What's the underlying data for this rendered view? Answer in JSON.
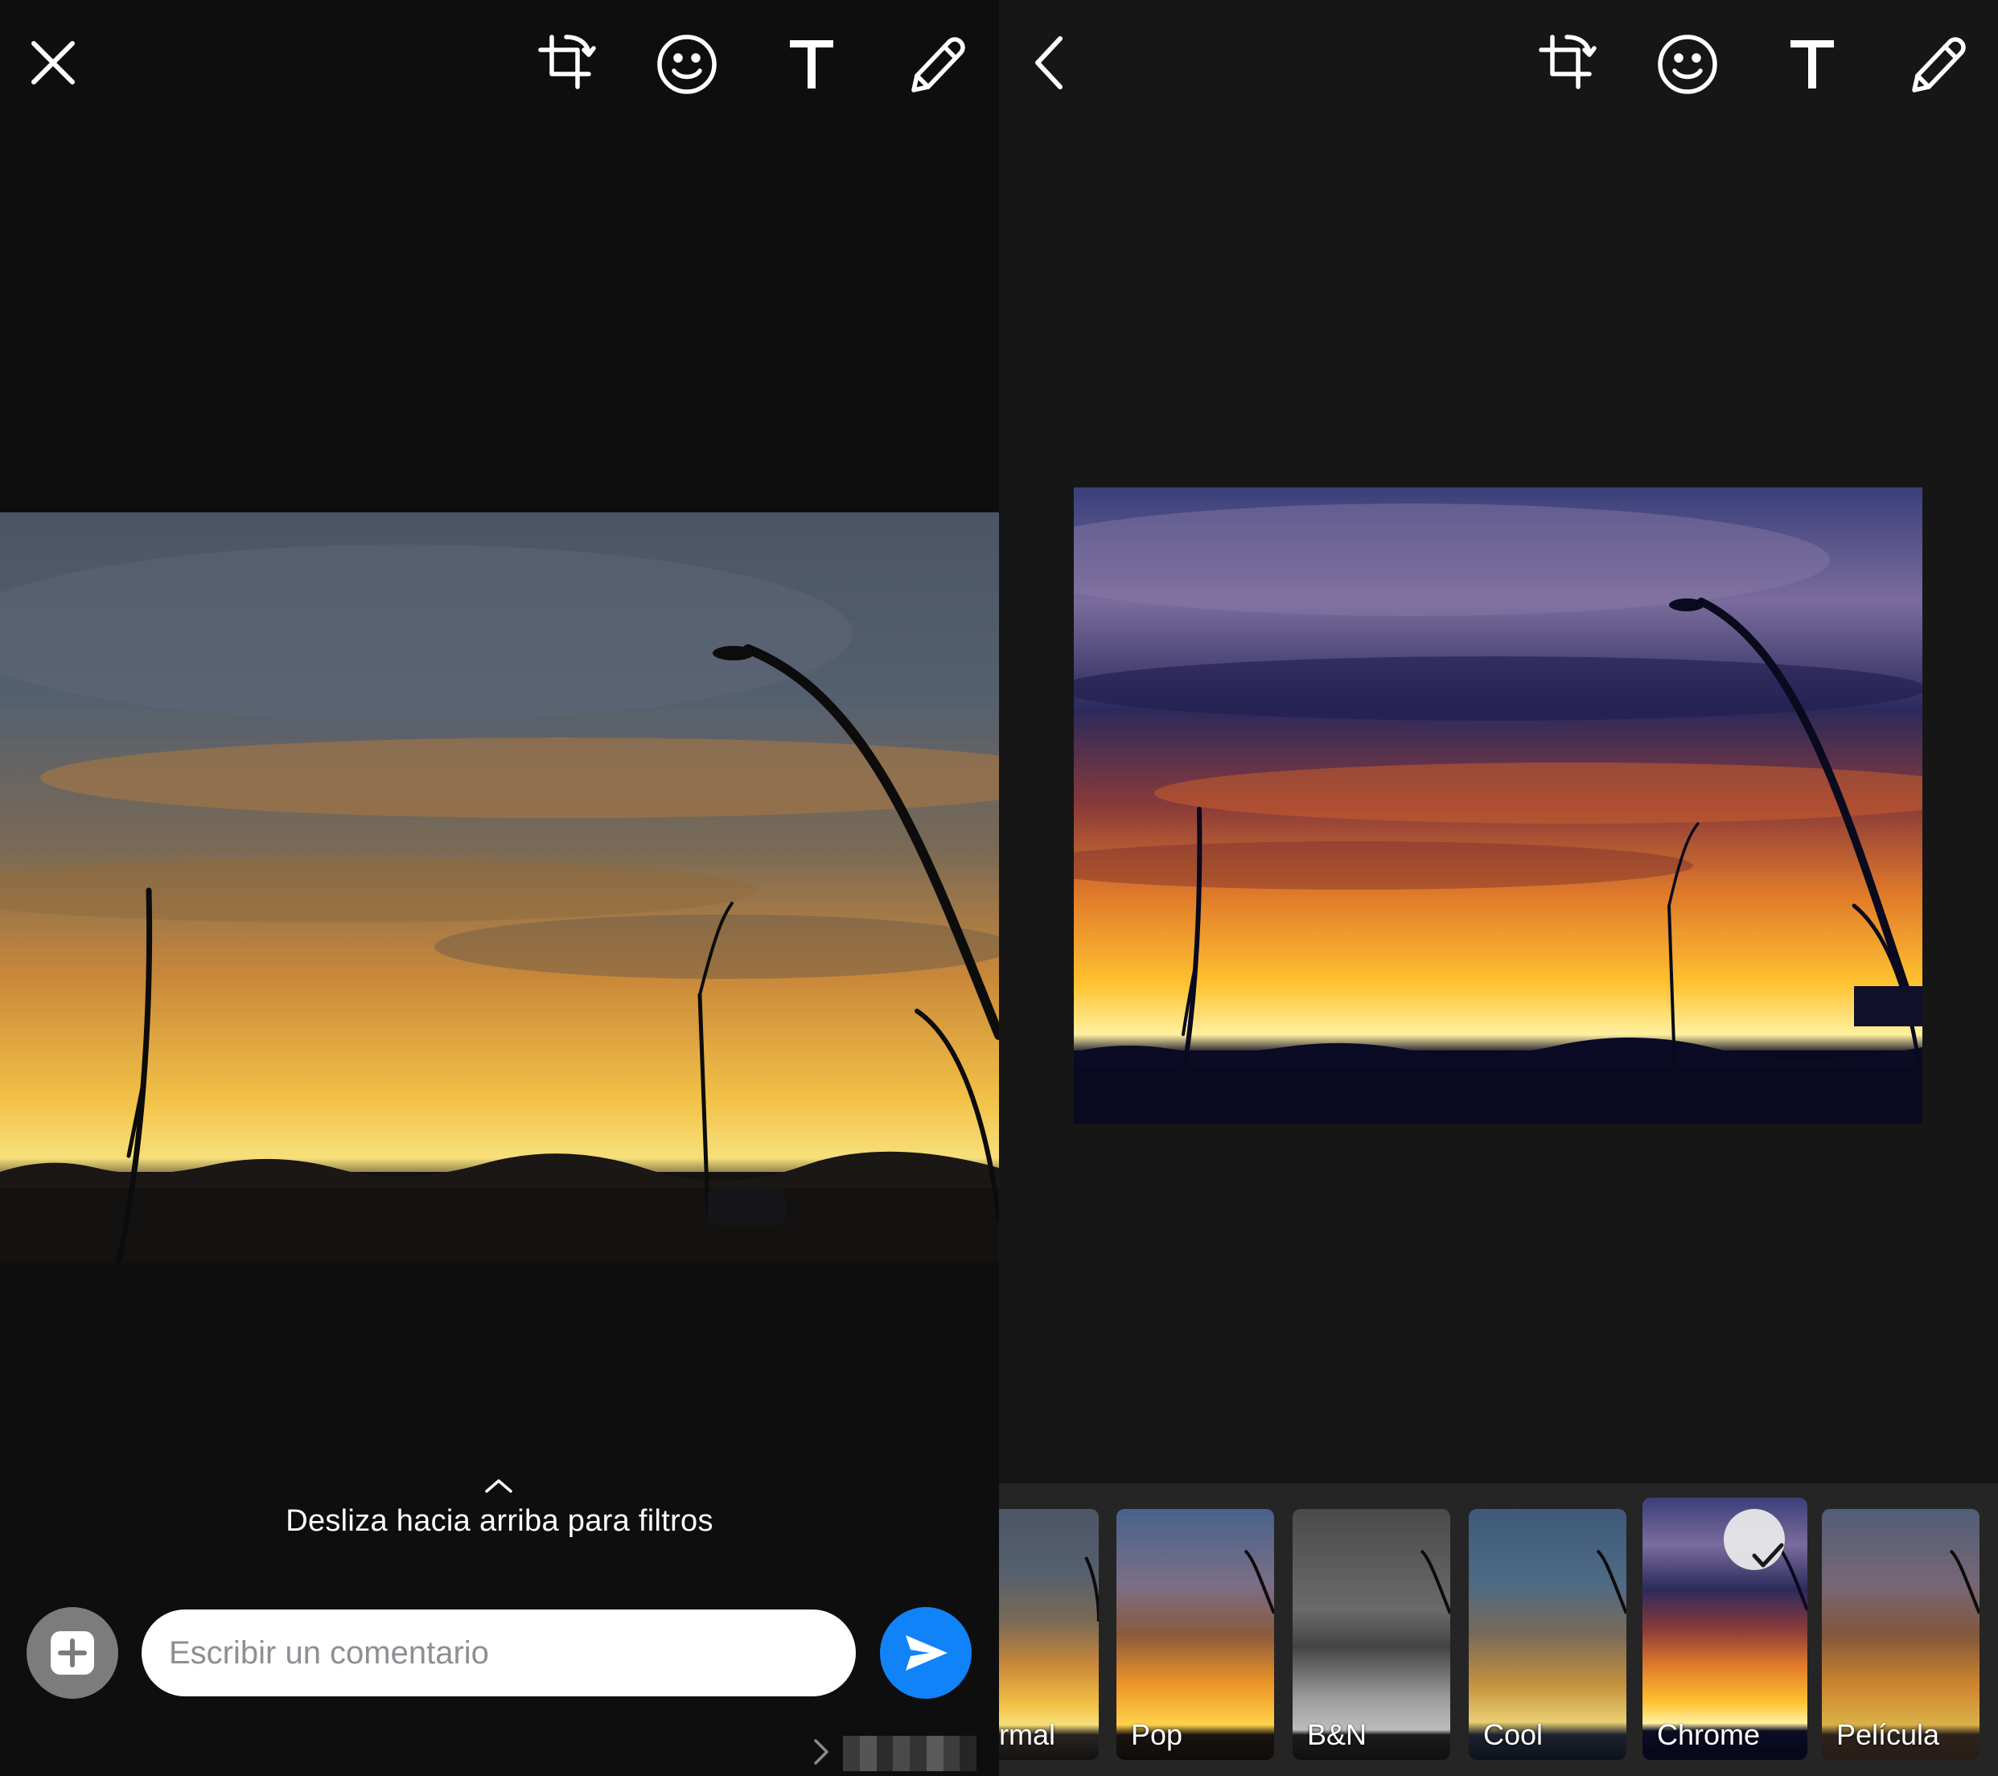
{
  "left_screen": {
    "close_icon": "close-icon",
    "toolbar": [
      "crop-rotate-icon",
      "emoji-icon",
      "text-icon",
      "pencil-icon"
    ],
    "hint": {
      "chevron_icon": "chevron-up-icon",
      "text": "Desliza hacia arriba para filtros"
    },
    "comment": {
      "placeholder": "Escribir un comentario",
      "value": ""
    },
    "add_icon": "add-media-icon",
    "send_icon": "send-icon"
  },
  "right_screen": {
    "back_icon": "back-chevron-icon",
    "toolbar": [
      "crop-rotate-icon",
      "emoji-icon",
      "text-icon",
      "pencil-icon"
    ],
    "filters": [
      {
        "label": "rmal",
        "selected": false
      },
      {
        "label": "Pop",
        "selected": false
      },
      {
        "label": "B&N",
        "selected": false
      },
      {
        "label": "Cool",
        "selected": false
      },
      {
        "label": "Chrome",
        "selected": true
      },
      {
        "label": "Película",
        "selected": false
      }
    ],
    "selected_check_icon": "checkmark-icon"
  },
  "colors": {
    "left_background": "#0e0e0e",
    "right_background": "#161616",
    "filter_strip": "#252525",
    "send_button": "#1083f8",
    "add_button": "#7c7c7c"
  }
}
